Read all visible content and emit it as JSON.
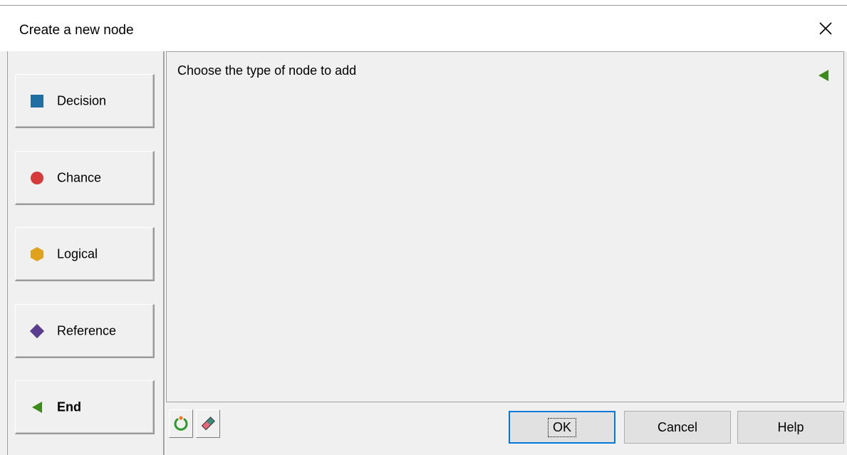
{
  "window": {
    "title": "Create a new node",
    "close_icon": "close-icon"
  },
  "node_types": [
    {
      "label": "Decision",
      "icon": "blue-square-icon",
      "color": "#1f6fa3"
    },
    {
      "label": "Chance",
      "icon": "red-circle-icon",
      "color": "#d63a3a"
    },
    {
      "label": "Logical",
      "icon": "orange-hexagon-icon",
      "color": "#e0a21c"
    },
    {
      "label": "Reference",
      "icon": "purple-diamond-icon",
      "color": "#5b3d8f"
    },
    {
      "label": "End",
      "icon": "green-triangle-icon",
      "color": "#3a8a1c"
    }
  ],
  "content": {
    "prompt": "Choose the type of node to add",
    "arrow_icon": "green-triangle-icon",
    "arrow_color": "#3a8a1c"
  },
  "toolbar": {
    "refresh_icon": "refresh-icon",
    "eraser_icon": "eraser-icon"
  },
  "buttons": {
    "ok": "OK",
    "cancel": "Cancel",
    "help": "Help"
  }
}
